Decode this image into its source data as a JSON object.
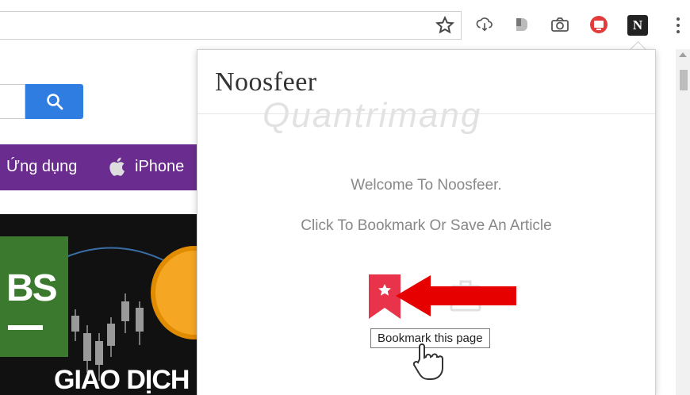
{
  "browser": {
    "icons": [
      "bookmark-star-icon",
      "cloud-download-icon",
      "extension-icon",
      "camera-icon",
      "screen-capture-icon",
      "noosfeer-extension-icon",
      "menu-icon"
    ],
    "noosfeer_letter": "N"
  },
  "page": {
    "search_icon": "search-icon",
    "nav": {
      "item1": "Ứng dụng",
      "item2": "iPhone"
    },
    "banner": {
      "logo_text": "BS",
      "headline": "GIAO DỊCH"
    }
  },
  "popup": {
    "brand": "Noosfeer",
    "watermark": "Quantrimang",
    "welcome": "Welcome To Noosfeer.",
    "instruction": "Click To Bookmark Or Save An Article",
    "tooltip": "Bookmark this page"
  },
  "colors": {
    "bookmark": "#e8334a",
    "arrow": "#e60000",
    "nav_bg": "#6a2c8f",
    "search_btn": "#2f7de1"
  }
}
